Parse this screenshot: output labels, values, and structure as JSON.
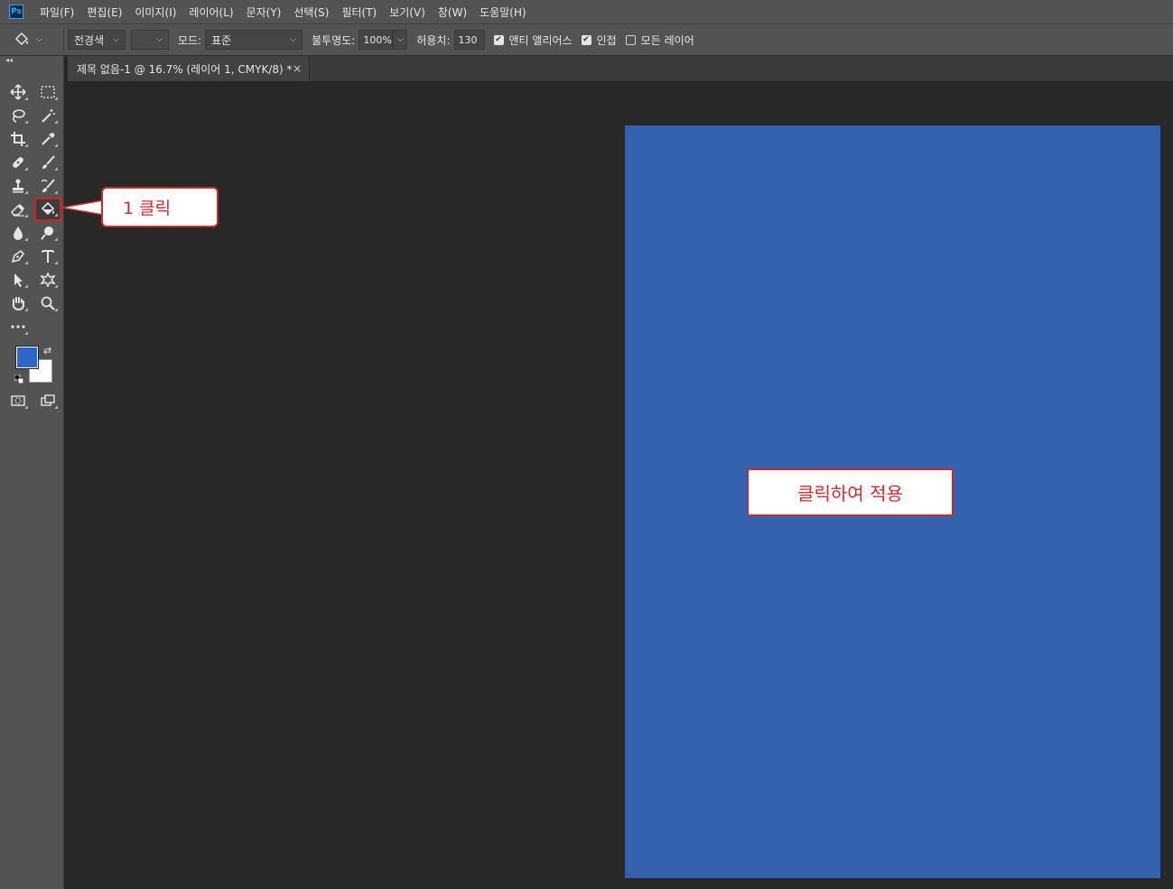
{
  "app": {
    "logo_text": "Ps"
  },
  "menu": [
    "파일(F)",
    "편집(E)",
    "이미지(I)",
    "레이어(L)",
    "문자(Y)",
    "선택(S)",
    "필터(T)",
    "보기(V)",
    "창(W)",
    "도움말(H)"
  ],
  "options": {
    "fill_source": "전경색",
    "pattern": "",
    "mode_label": "모드:",
    "mode_value": "표준",
    "opacity_label": "불투명도:",
    "opacity_value": "100%",
    "tolerance_label": "허용치:",
    "tolerance_value": "130",
    "antialias_label": "앤티 앨리어스",
    "antialias_checked": true,
    "contiguous_label": "인접",
    "contiguous_checked": true,
    "all_layers_label": "모든 레이어",
    "all_layers_checked": false
  },
  "tab": {
    "title": "제목 없음-1 @ 16.7% (레이어 1, CMYK/8) *",
    "close": "×"
  },
  "colors": {
    "foreground": "#2f66c9",
    "background": "#ffffff",
    "document_fill": "#3462ae"
  },
  "annotations": {
    "step1": "1 클릭",
    "step2": "클릭하여 적용"
  },
  "tools": [
    "move-icon",
    "marquee-icon",
    "lasso-icon",
    "magic-wand-icon",
    "crop-icon",
    "eyedropper-icon",
    "healing-icon",
    "brush-icon",
    "stamp-icon",
    "history-brush-icon",
    "eraser-icon",
    "paint-bucket-icon",
    "blur-icon",
    "dodge-icon",
    "pen-icon",
    "type-icon",
    "path-select-icon",
    "shape-icon",
    "hand-icon",
    "zoom-icon",
    "more-icon",
    "quickmask-icon",
    "screen-mode-icon"
  ]
}
